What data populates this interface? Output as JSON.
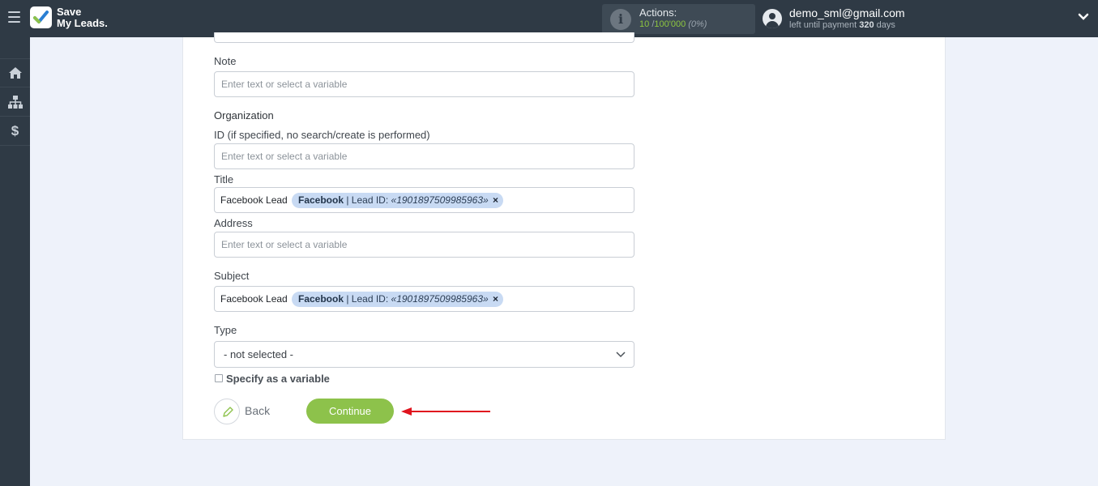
{
  "header": {
    "logo_line1": "Save",
    "logo_line2": "My Leads.",
    "actions_title": "Actions:",
    "actions_used": "10",
    "actions_separator": "/",
    "actions_total": "100'000",
    "actions_percent": "(0%)",
    "user_email": "demo_sml@gmail.com",
    "payment_prefix": "left until payment",
    "payment_days": "320",
    "payment_suffix": "days"
  },
  "sidebar": {
    "items": [
      {
        "icon": "home-icon"
      },
      {
        "icon": "sitemap-icon"
      },
      {
        "icon": "dollar-icon",
        "glyph": "$"
      }
    ]
  },
  "form": {
    "note_label": "Note",
    "note_placeholder": "Enter text or select a variable",
    "org_heading": "Organization",
    "org_id_label": "ID (if specified, no search/create is performed)",
    "org_id_placeholder": "Enter text or select a variable",
    "title_label": "Title",
    "title_value": "Facebook Lead",
    "title_chip_source": "Facebook",
    "title_chip_field": "| Lead ID:",
    "title_chip_value": "«1901897509985963»",
    "title_chip_remove": "×",
    "address_label": "Address",
    "address_placeholder": "Enter text or select a variable",
    "subject_label": "Subject",
    "subject_value": "Facebook Lead",
    "subject_chip_source": "Facebook",
    "subject_chip_field": "| Lead ID:",
    "subject_chip_value": "«1901897509985963»",
    "subject_chip_remove": "×",
    "type_label": "Type",
    "type_selected": "- not selected -",
    "specify_variable_label": "Specify as a variable"
  },
  "buttons": {
    "back_label": "Back",
    "continue_label": "Continue"
  },
  "colors": {
    "topbar": "#2f3a45",
    "accent_green": "#8dc24b",
    "chip_bg": "#c8daf3",
    "annotation_arrow": "#e0141e"
  }
}
